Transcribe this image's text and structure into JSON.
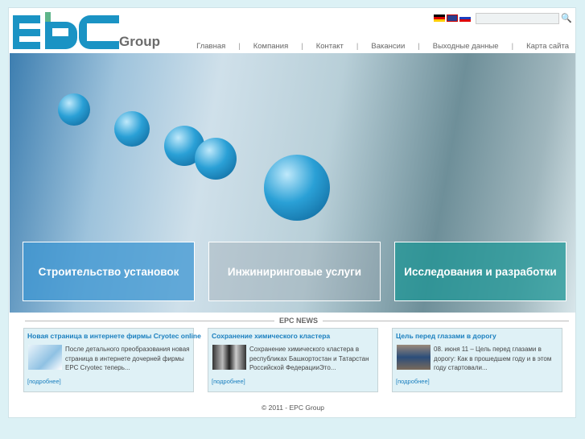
{
  "logo": {
    "text": "EPC",
    "group": "Group"
  },
  "languages": [
    "de-flag-icon",
    "en-flag-icon",
    "ru-flag-icon"
  ],
  "search": {
    "placeholder": ""
  },
  "nav": [
    "Главная",
    "Компания",
    "Контакт",
    "Вакансии",
    "Выходные данные",
    "Карта сайта"
  ],
  "banner": {
    "tiles": [
      "Строительство установок",
      "Инжиниринговые услуги",
      "Исследования и разработки"
    ]
  },
  "news": {
    "title": "EPC NEWS",
    "items": [
      {
        "title": "Новая страница в интернете фирмы Cryotec online",
        "text": "После детального преобразования новая страница в интернете дочерней фирмы EPC Cryotec теперь...",
        "more": "[подробнее]"
      },
      {
        "title": "Сохранение химического кластера",
        "text": "Сохранение химического кластера в республиках Башкортостан и Татарстан Российской ФедерацииЭто...",
        "more": "[подробнее]"
      },
      {
        "title": "Цель перед глазами в дорогу",
        "text": "08. июня 11 – Цель перед глазами в дорогу: Как в прошедшем году и в этом году стартовали...",
        "more": "[подробнее]"
      }
    ]
  },
  "footer": {
    "copyright": "© 2011 - EPC Group"
  },
  "colors": {
    "brand": "#1a93c4",
    "tile1": "#4ba3d6",
    "tile3": "#2f9a9a"
  }
}
